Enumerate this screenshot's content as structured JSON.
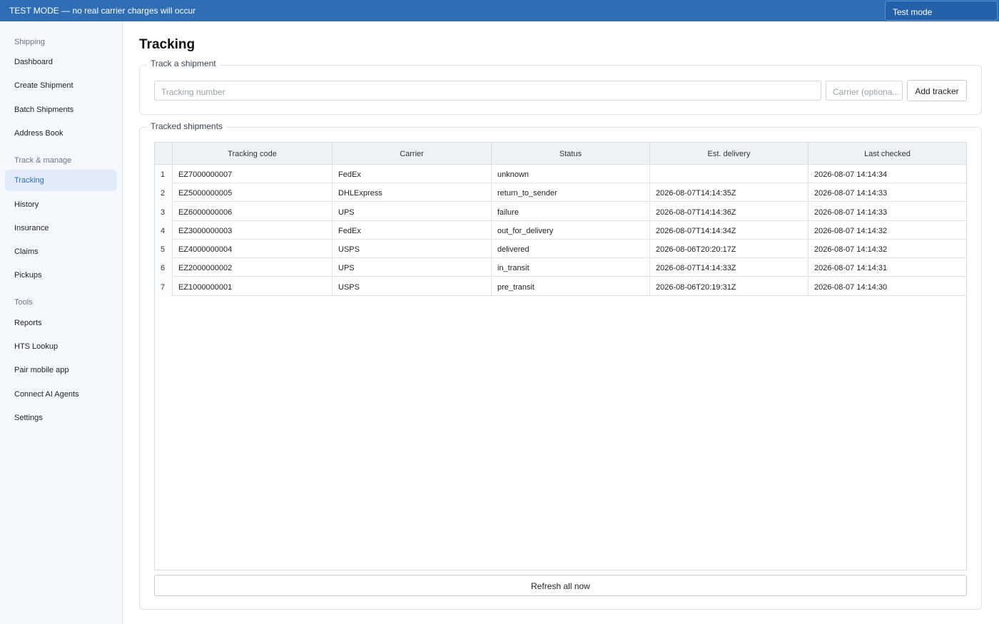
{
  "banner": {
    "text": "TEST MODE — no real carrier charges will occur",
    "mode_select": "Test mode"
  },
  "sidebar": {
    "groups": [
      {
        "label": "Shipping",
        "items": [
          {
            "label": "Dashboard"
          },
          {
            "label": "Create Shipment"
          },
          {
            "label": "Batch Shipments"
          },
          {
            "label": "Address Book"
          }
        ]
      },
      {
        "label": "Track & manage",
        "items": [
          {
            "label": "Tracking",
            "active": true
          },
          {
            "label": "History"
          },
          {
            "label": "Insurance"
          },
          {
            "label": "Claims"
          },
          {
            "label": "Pickups"
          }
        ]
      },
      {
        "label": "Tools",
        "items": [
          {
            "label": "Reports"
          },
          {
            "label": "HTS Lookup"
          },
          {
            "label": "Pair mobile app"
          },
          {
            "label": "Connect AI Agents"
          },
          {
            "label": "Settings"
          }
        ]
      }
    ]
  },
  "page": {
    "title": "Tracking",
    "track_section": {
      "legend": "Track a shipment",
      "tracking_placeholder": "Tracking number",
      "carrier_placeholder": "Carrier (optiona...",
      "add_button": "Add tracker"
    },
    "tracked_section": {
      "legend": "Tracked shipments",
      "columns": [
        "Tracking code",
        "Carrier",
        "Status",
        "Est. delivery",
        "Last checked"
      ],
      "rows": [
        {
          "num": "1",
          "code": "EZ7000000007",
          "carrier": "FedEx",
          "status": "unknown",
          "est": "",
          "last": "2026-08-07 14:14:34"
        },
        {
          "num": "2",
          "code": "EZ5000000005",
          "carrier": "DHLExpress",
          "status": "return_to_sender",
          "est": "2026-08-07T14:14:35Z",
          "last": "2026-08-07 14:14:33"
        },
        {
          "num": "3",
          "code": "EZ6000000006",
          "carrier": "UPS",
          "status": "failure",
          "est": "2026-08-07T14:14:36Z",
          "last": "2026-08-07 14:14:33"
        },
        {
          "num": "4",
          "code": "EZ3000000003",
          "carrier": "FedEx",
          "status": "out_for_delivery",
          "est": "2026-08-07T14:14:34Z",
          "last": "2026-08-07 14:14:32"
        },
        {
          "num": "5",
          "code": "EZ4000000004",
          "carrier": "USPS",
          "status": "delivered",
          "est": "2026-08-06T20:20:17Z",
          "last": "2026-08-07 14:14:32"
        },
        {
          "num": "6",
          "code": "EZ2000000002",
          "carrier": "UPS",
          "status": "in_transit",
          "est": "2026-08-07T14:14:33Z",
          "last": "2026-08-07 14:14:31"
        },
        {
          "num": "7",
          "code": "EZ1000000001",
          "carrier": "USPS",
          "status": "pre_transit",
          "est": "2026-08-06T20:19:31Z",
          "last": "2026-08-07 14:14:30"
        }
      ],
      "refresh_button": "Refresh all now"
    }
  }
}
